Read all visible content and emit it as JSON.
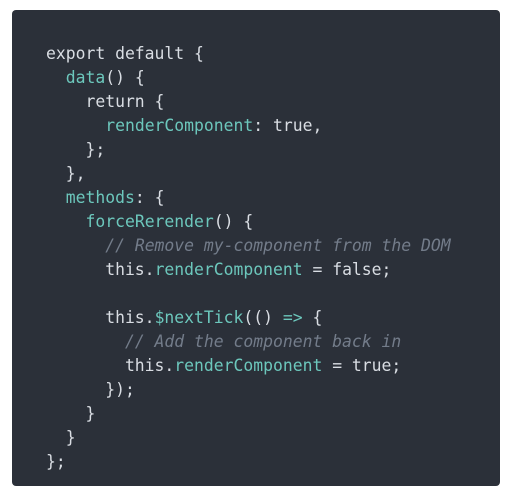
{
  "colors": {
    "background": "#2b3039",
    "plain": "#d9dde3",
    "identifier": "#6cc7bc",
    "comment": "#737c8a"
  },
  "code": {
    "language": "javascript",
    "lines": [
      [
        {
          "t": "export default {",
          "c": "plain"
        }
      ],
      [
        {
          "t": "  ",
          "c": "plain"
        },
        {
          "t": "data",
          "c": "teal"
        },
        {
          "t": "() {",
          "c": "plain"
        }
      ],
      [
        {
          "t": "    return {",
          "c": "plain"
        }
      ],
      [
        {
          "t": "      ",
          "c": "plain"
        },
        {
          "t": "renderComponent",
          "c": "teal"
        },
        {
          "t": ": true,",
          "c": "plain"
        }
      ],
      [
        {
          "t": "    };",
          "c": "plain"
        }
      ],
      [
        {
          "t": "  },",
          "c": "plain"
        }
      ],
      [
        {
          "t": "  ",
          "c": "plain"
        },
        {
          "t": "methods",
          "c": "teal"
        },
        {
          "t": ": {",
          "c": "plain"
        }
      ],
      [
        {
          "t": "    ",
          "c": "plain"
        },
        {
          "t": "forceRerender",
          "c": "teal"
        },
        {
          "t": "() {",
          "c": "plain"
        }
      ],
      [
        {
          "t": "      ",
          "c": "plain"
        },
        {
          "t": "// Remove my-component from the DOM",
          "c": "cmt"
        }
      ],
      [
        {
          "t": "      this.",
          "c": "plain"
        },
        {
          "t": "renderComponent",
          "c": "teal"
        },
        {
          "t": " = false;",
          "c": "plain"
        }
      ],
      [
        {
          "t": "",
          "c": "plain"
        }
      ],
      [
        {
          "t": "      this.",
          "c": "plain"
        },
        {
          "t": "$nextTick",
          "c": "teal"
        },
        {
          "t": "(() ",
          "c": "plain"
        },
        {
          "t": "=>",
          "c": "teal"
        },
        {
          "t": " {",
          "c": "plain"
        }
      ],
      [
        {
          "t": "        ",
          "c": "plain"
        },
        {
          "t": "// Add the component back in",
          "c": "cmt"
        }
      ],
      [
        {
          "t": "        this.",
          "c": "plain"
        },
        {
          "t": "renderComponent",
          "c": "teal"
        },
        {
          "t": " = true;",
          "c": "plain"
        }
      ],
      [
        {
          "t": "      });",
          "c": "plain"
        }
      ],
      [
        {
          "t": "    }",
          "c": "plain"
        }
      ],
      [
        {
          "t": "  }",
          "c": "plain"
        }
      ],
      [
        {
          "t": "};",
          "c": "plain"
        }
      ]
    ]
  }
}
